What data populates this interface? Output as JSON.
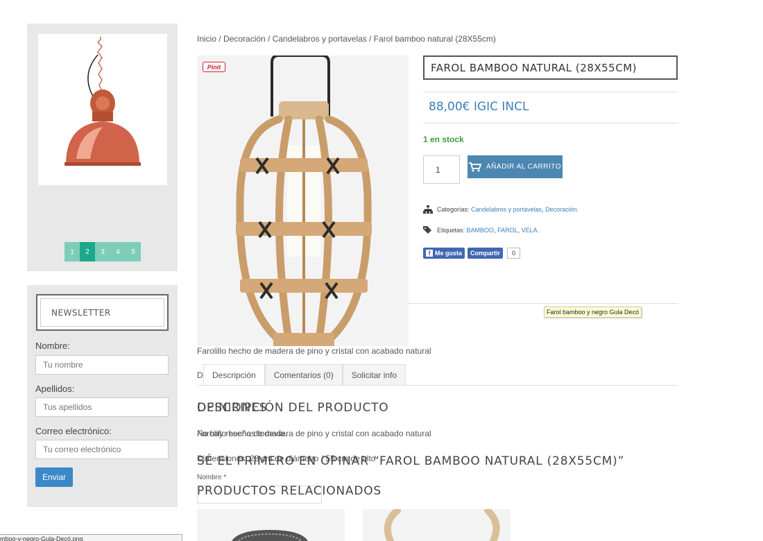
{
  "sidebar": {
    "slider": {
      "pages": [
        "1",
        "2",
        "3",
        "4",
        "5"
      ],
      "active_page": "2"
    },
    "newsletter": {
      "title": "NEWSLETTER",
      "nombre_label": "Nombre:",
      "nombre_placeholder": "Tu nombre",
      "apellidos_label": "Apellidos:",
      "apellidos_placeholder": "Tus apellidos",
      "email_label": "Correo electrónico:",
      "email_placeholder": "Tu correo electrónico",
      "submit_label": "Enviar"
    },
    "filebar": "mboo-y-negro-Gula-Decó.png"
  },
  "breadcrumb": "Inicio / Decoración / Candelabros y portavelas / Farol bamboo natural (28X55cm)",
  "product": {
    "pinit_label": "Pinit",
    "title": "FAROL BAMBOO NATURAL (28X55CM)",
    "price": "88,00€ IGIC INCL",
    "stock": "1 en stock",
    "quantity": "1",
    "add_to_cart": "AÑADIR AL CARRITO",
    "categories_label": "Categorías:",
    "categories": [
      "Candelabros y portavelas",
      "Decoración"
    ],
    "tags_label": "Etiquetas:",
    "tags": [
      "BAMBOO",
      "FAROL",
      "VELA"
    ],
    "fb_like": "Me gusta",
    "fb_share": "Compartir",
    "fb_count": "0",
    "tooltip": "Farol bamboo y negro Gula Decó",
    "short_description": "Farolillo hecho de madera de pino y cristal con  acabado natural"
  },
  "tabs": {
    "stub": "D",
    "items": [
      "Descripción",
      "Comentarios (0)",
      "Solicitar info"
    ],
    "active": "Descripción"
  },
  "overlapping": {
    "heading_a": "DESCRIPCIÓN DEL PRODUCTO",
    "heading_b": "OPINIONES",
    "line_a": "Farolillo hecho de madera de pino y cristal con  acabado natural",
    "line_b": "No hay reseñas todavía.",
    "dimensions": "Dimensiones: 28 cm de diámetro / 55 cm de alto",
    "review_prompt": "SÉ EL PRIMERO EN OPINAR “FAROL BAMBOO NATURAL (28X55CM)”",
    "nombre_label": "Nombre *",
    "related_heading": "PRODUCTOS RELACIONADOS"
  },
  "colors": {
    "accent": "#3b7fb6",
    "pager": "#7ecdb8",
    "pager_active": "#1aa98a",
    "cart_button": "#4c87b1",
    "stock_green": "#3c9b3c"
  }
}
